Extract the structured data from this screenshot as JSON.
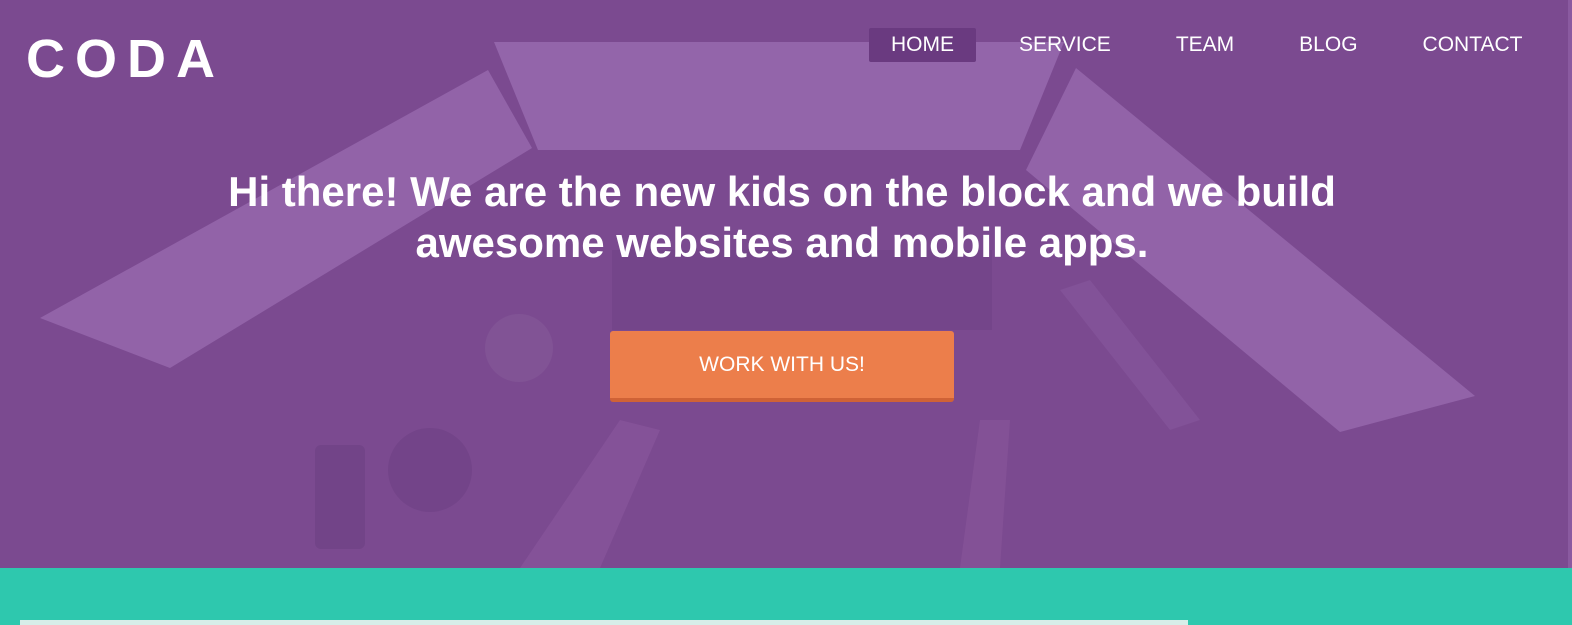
{
  "brand": {
    "logo_text": "CODA"
  },
  "nav": {
    "items": [
      {
        "label": "HOME",
        "active": true
      },
      {
        "label": "SERVICE",
        "active": false
      },
      {
        "label": "TEAM",
        "active": false
      },
      {
        "label": "BLOG",
        "active": false
      },
      {
        "label": "CONTACT",
        "active": false
      }
    ]
  },
  "hero": {
    "headline_line1": "Hi there! We are the new kids on the block and we build",
    "headline_line2": "awesome websites and mobile apps.",
    "cta_label": "WORK WITH US!"
  },
  "colors": {
    "hero_overlay": "#7b4a90",
    "nav_active_bg": "#6a3a80",
    "cta": "#ec7e4b",
    "cta_shadow": "#cf6236",
    "teal": "#2ec8ae"
  }
}
